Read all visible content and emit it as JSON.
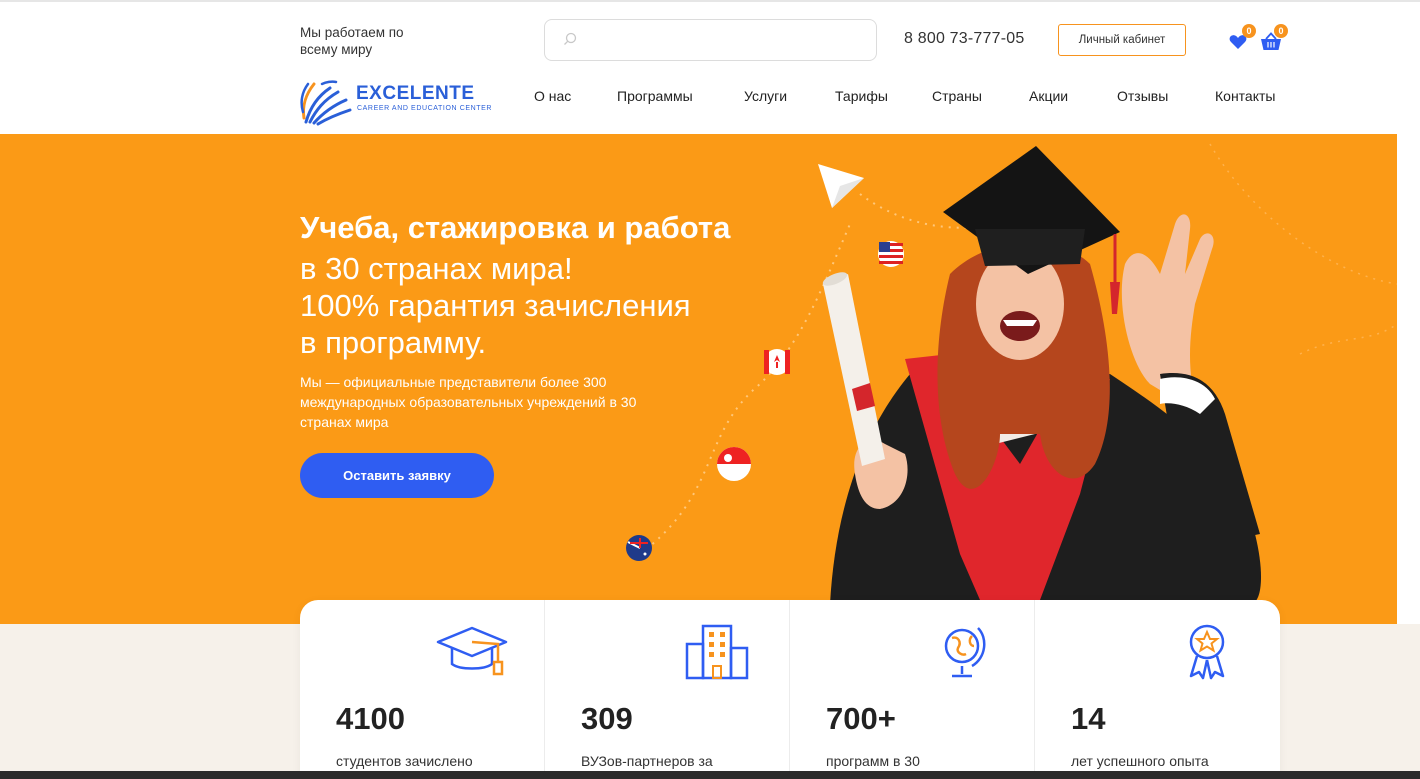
{
  "header": {
    "world_text": "Мы работаем по всему миру",
    "search_placeholder": "",
    "phone": "8 800 73-777-05",
    "cabinet_label": "Личный кабинет",
    "favorites_count": "0",
    "cart_count": "0",
    "logo_name": "EXCELENTE",
    "logo_sub": "CAREER AND EDUCATION CENTER"
  },
  "nav": [
    "О нас",
    "Программы",
    "Услуги",
    "Тарифы",
    "Страны",
    "Акции",
    "Отзывы",
    "Контакты"
  ],
  "hero": {
    "title": "Учеба, стажировка и работа",
    "subtitle_lines": [
      "в 30 странах мира!",
      "100% гарантия зачисления",
      "в программу."
    ],
    "description": "Мы — официальные представители более 300 международных образовательных учреждений в 30 странах мира",
    "cta_label": "Оставить заявку",
    "flags": [
      "usa-flag-icon",
      "canada-flag-icon",
      "singapore-flag-icon",
      "australia-flag-icon"
    ]
  },
  "stats": [
    {
      "icon": "graduation-cap-icon",
      "number": "4100",
      "label": "студентов зачислено"
    },
    {
      "icon": "university-building-icon",
      "number": "309",
      "label": "ВУЗов-партнеров за"
    },
    {
      "icon": "globe-icon",
      "number": "700+",
      "label": "программ в 30"
    },
    {
      "icon": "award-medal-icon",
      "number": "14",
      "label": "лет успешного опыта"
    }
  ],
  "colors": {
    "accent_orange": "#fb9a16",
    "brand_blue": "#2f5df2",
    "logo_blue": "#2a5fd8",
    "white": "#ffffff"
  }
}
